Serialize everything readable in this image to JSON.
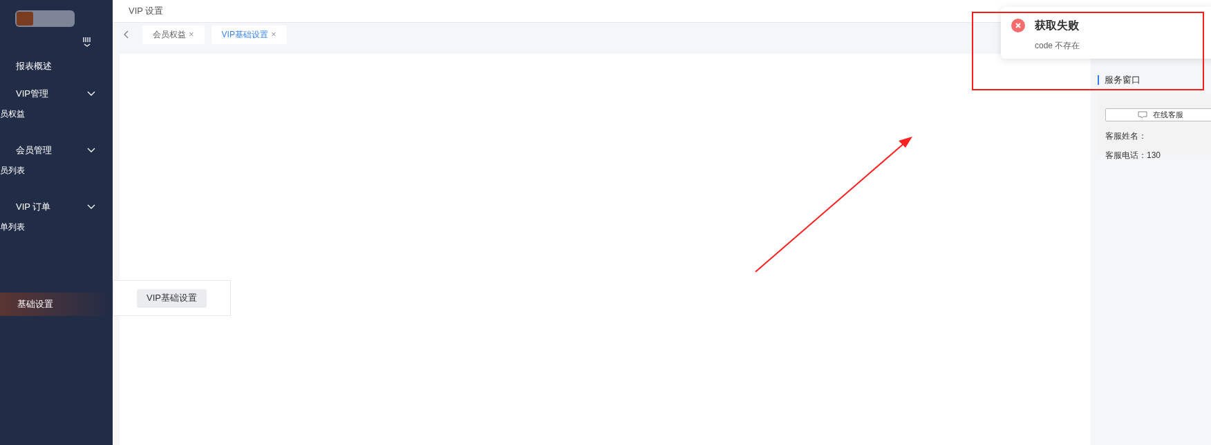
{
  "page_title": "VIP 设置",
  "sidebar": {
    "items": [
      {
        "label": "报表概述",
        "kind": "item",
        "selected": false
      },
      {
        "label": "VIP管理",
        "kind": "group",
        "expanded": true,
        "children": [
          {
            "label": "员权益",
            "selected": false
          }
        ]
      },
      {
        "label": "会员管理",
        "kind": "group",
        "expanded": true,
        "children": [
          {
            "label": "员列表",
            "selected": false
          }
        ]
      },
      {
        "label": "VIP 订单",
        "kind": "group",
        "expanded": true,
        "children": [
          {
            "label": "单列表",
            "selected": false
          }
        ]
      },
      {
        "label": "基础设置",
        "kind": "item",
        "selected": true
      }
    ]
  },
  "tabs": [
    {
      "label": "会员权益",
      "close": "×",
      "selected": false
    },
    {
      "label": "VIP基础设置",
      "close": "×",
      "selected": true
    }
  ],
  "popup_menu": {
    "items": [
      "VIP基础设置"
    ]
  },
  "notification": {
    "kind": "error",
    "title": "获取失败",
    "message": "code 不存在"
  },
  "service_panel": {
    "title": "服务窗口",
    "button": "在线客服",
    "rows": [
      "客服姓名：",
      "客服电话：130"
    ]
  }
}
